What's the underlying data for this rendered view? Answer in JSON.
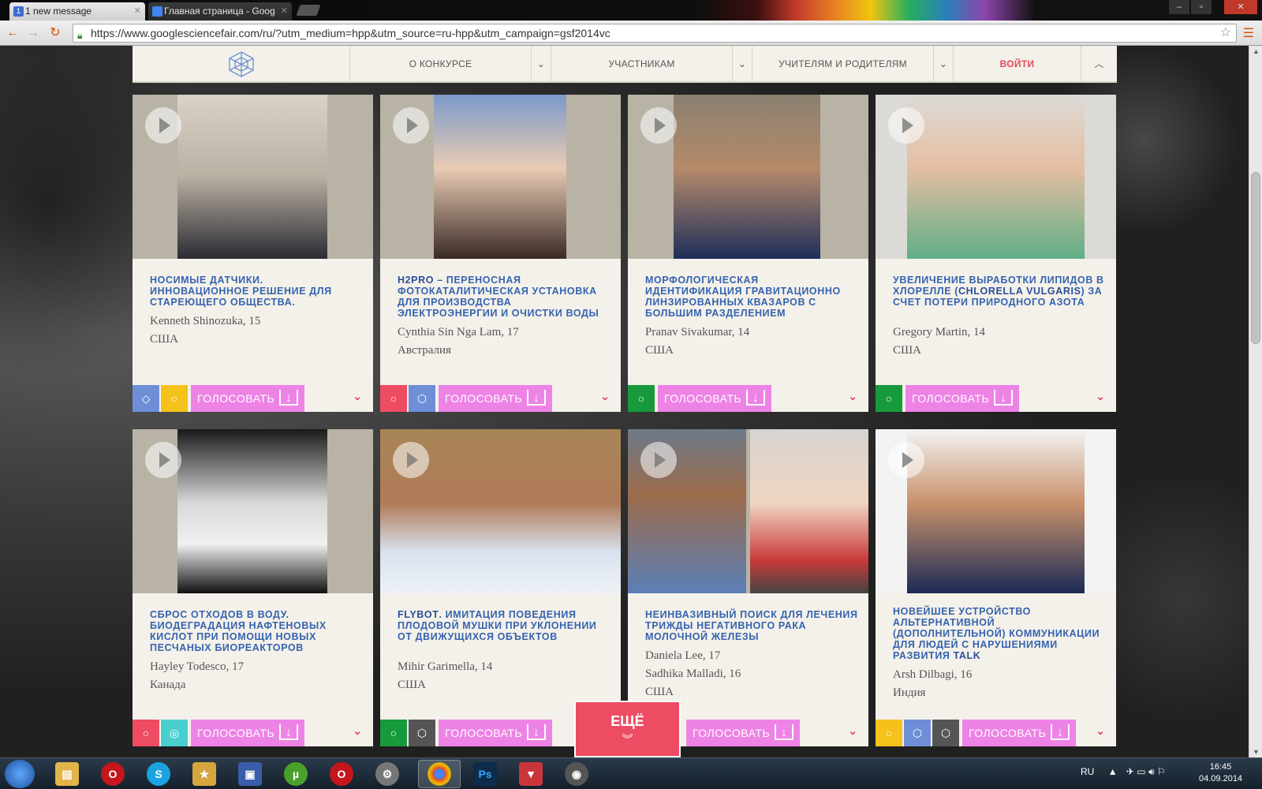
{
  "browser": {
    "tabs": [
      {
        "favicon": "1",
        "title": "1 new message"
      },
      {
        "title": "Главная страница - Goog"
      }
    ],
    "url": "https://www.googlesciencefair.com/ru/?utm_medium=hpp&utm_source=ru-hpp&utm_campaign=gsf2014vc"
  },
  "nav": {
    "items": [
      "О КОНКУРСЕ",
      "УЧАСТНИКАМ",
      "УЧИТЕЛЯМ И РОДИТЕЛЯМ"
    ],
    "login": "ВОЙТИ"
  },
  "vote_label": "ГОЛОСОВАТЬ",
  "cards": [
    {
      "title_pre": "",
      "title_strong": "",
      "title": "НОСИМЫЕ ДАТЧИКИ. ИННОВАЦИОННОЕ РЕШЕНИЕ ДЛЯ СТАРЕЮЩЕГО ОБЩЕСТВА.",
      "names": [
        "Kenneth Shinozuka, 15",
        "США"
      ]
    },
    {
      "title_strong": "H2PRO",
      "title": " – ПЕРЕНОСНАЯ ФОТОКАТАЛИТИЧЕСКАЯ УСТАНОВКА ДЛЯ ПРОИЗВОДСТВА ЭЛЕКТРОЭНЕРГИИ И ОЧИСТКИ ВОДЫ",
      "names": [
        "Cynthia Sin Nga Lam, 17",
        "Австралия"
      ]
    },
    {
      "title": "МОРФОЛОГИЧЕСКАЯ ИДЕНТИФИКАЦИЯ ГРАВИТАЦИОННО ЛИНЗИРОВАННЫХ КВАЗАРОВ С БОЛЬШИМ РАЗДЕЛЕНИЕМ",
      "names": [
        "Pranav Sivakumar, 14",
        "США"
      ]
    },
    {
      "title_pre": "УВЕЛИЧЕНИЕ ВЫРАБОТКИ ЛИПИДОВ В ХЛОРЕЛЛЕ (",
      "title_strong": "CHLORELLA VULGARIS",
      "title": ") ЗА СЧЕТ ПОТЕРИ ПРИРОДНОГО АЗОТА",
      "names": [
        "Gregory Martin, 14",
        "США"
      ]
    },
    {
      "title": "СБРОС ОТХОДОВ В ВОДУ. БИОДЕГРАДАЦИЯ НАФТЕНОВЫХ КИСЛОТ ПРИ ПОМОЩИ НОВЫХ ПЕСЧАНЫХ БИОРЕАКТОРОВ",
      "names": [
        "Hayley Todesco, 17",
        "Канада"
      ]
    },
    {
      "title_strong": "FLYBOT",
      "title": ". ИМИТАЦИЯ ПОВЕДЕНИЯ ПЛОДОВОЙ МУШКИ ПРИ УКЛОНЕНИИ ОТ ДВИЖУЩИХСЯ ОБЪЕКТОВ",
      "names": [
        "Mihir Garimella, 14",
        "США"
      ]
    },
    {
      "title": "НЕИНВАЗИВНЫЙ ПОИСК ДЛЯ ЛЕЧЕНИЯ ТРИЖДЫ НЕГАТИВНОГО РАКА МОЛОЧНОЙ ЖЕЛЕЗЫ",
      "names": [
        "Daniela Lee, 17",
        "Sadhika Malladi, 16",
        "США"
      ]
    },
    {
      "title_pre": "НОВЕЙШЕЕ УСТРОЙСТВО АЛЬТЕРНАТИВНОЙ (ДОПОЛНИТЕЛЬНОЙ) КОММУНИКАЦИИ ДЛЯ ЛЮДЕЙ С НАРУШЕНИЯМИ РАЗВИТИЯ ",
      "title_strong": "TALK",
      "title": "",
      "names": [
        "Arsh Dilbagi, 16",
        "Индия"
      ]
    }
  ],
  "more_label": "ЕЩЁ",
  "taskbar": {
    "lang": "RU",
    "time": "16:45",
    "date": "04.09.2014"
  },
  "colors": {
    "accent": "#ee4c63",
    "vote": "#ee83e6",
    "title": "#3563b0",
    "card_bg": "#f4f1ea"
  }
}
